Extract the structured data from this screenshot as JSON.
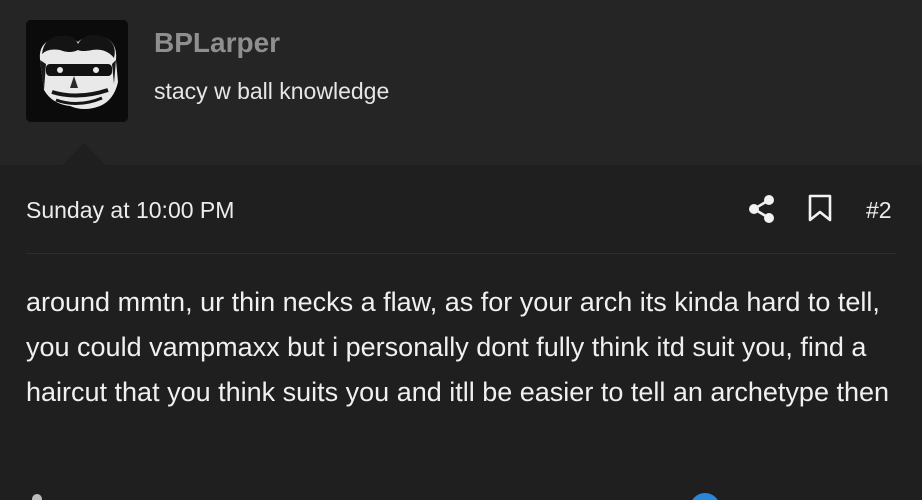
{
  "user": {
    "name": "BPLarper",
    "title": "stacy w ball knowledge",
    "avatar_icon": "face-portrait-avatar"
  },
  "post": {
    "date": "Sunday at 10:00 PM",
    "number": "#2",
    "share_icon": "share-icon",
    "bookmark_icon": "bookmark-icon",
    "message": "around mmtn, ur thin necks a flaw, as for your arch its kinda hard to tell, you could vampmaxx but i personally dont fully think itd suit you, find a haircut that you think suits you and itll be easier to tell an archetype then"
  },
  "colors": {
    "background": "#222223",
    "header_bg": "#252525",
    "body_bg": "#1f1f1f",
    "username": "#8f8f8f",
    "accent_blue": "#2a86d8"
  }
}
